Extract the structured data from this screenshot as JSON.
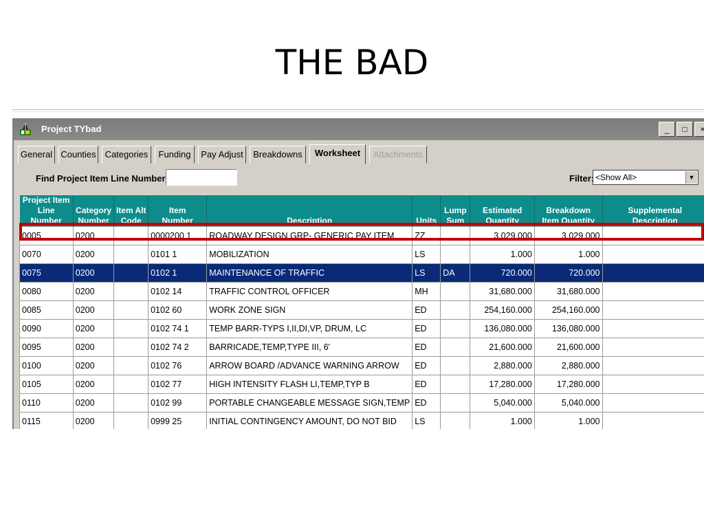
{
  "slide": {
    "title": "THE BAD"
  },
  "window": {
    "title": "Project TYbad",
    "minimize": "_",
    "maximize": "□",
    "close": "×"
  },
  "tabs": [
    {
      "label": "General",
      "state": "normal"
    },
    {
      "label": "Counties",
      "state": "normal"
    },
    {
      "label": "Categories",
      "state": "normal"
    },
    {
      "label": "Funding",
      "state": "normal"
    },
    {
      "label": "Pay Adjust",
      "state": "normal"
    },
    {
      "label": "Breakdowns",
      "state": "normal"
    },
    {
      "label": "Worksheet",
      "state": "active"
    },
    {
      "label": "Attachments",
      "state": "disabled"
    }
  ],
  "find": {
    "label": "Find Project Item Line Number:",
    "value": ""
  },
  "filter": {
    "label": "Filter:",
    "value": "<Show All>"
  },
  "columns": [
    [
      "Project Item",
      "Line Number"
    ],
    [
      "Category",
      "Number"
    ],
    [
      "Item Alt",
      "Code"
    ],
    [
      "Item",
      "Number"
    ],
    [
      "",
      "Description"
    ],
    [
      "",
      "Units"
    ],
    [
      "Lump",
      "Sum"
    ],
    [
      "Estimated",
      "Quantity"
    ],
    [
      "Breakdown",
      "Item Quantity"
    ],
    [
      "Supplemental",
      "Description"
    ]
  ],
  "rows": [
    [
      "0005",
      "0200",
      "",
      "0000200 1",
      "ROADWAY DESIGN GRP- GENERIC PAY ITEM",
      "ZZ",
      "",
      "3,029.000",
      "3,029.000",
      ""
    ],
    [
      "0070",
      "0200",
      "",
      "0101 1",
      "MOBILIZATION",
      "LS",
      "",
      "1.000",
      "1.000",
      ""
    ],
    [
      "0075",
      "0200",
      "",
      "0102 1",
      "MAINTENANCE OF TRAFFIC",
      "LS",
      "DA",
      "720.000",
      "720.000",
      ""
    ],
    [
      "0080",
      "0200",
      "",
      "0102 14",
      "TRAFFIC CONTROL OFFICER",
      "MH",
      "",
      "31,680.000",
      "31,680.000",
      ""
    ],
    [
      "0085",
      "0200",
      "",
      "0102 60",
      "WORK ZONE SIGN",
      "ED",
      "",
      "254,160.000",
      "254,160.000",
      ""
    ],
    [
      "0090",
      "0200",
      "",
      "0102 74 1",
      "TEMP BARR-TYPS I,II,DI,VP, DRUM, LC",
      "ED",
      "",
      "136,080.000",
      "136,080.000",
      ""
    ],
    [
      "0095",
      "0200",
      "",
      "0102 74 2",
      "BARRICADE,TEMP,TYPE III, 6'",
      "ED",
      "",
      "21,600.000",
      "21,600.000",
      ""
    ],
    [
      "0100",
      "0200",
      "",
      "0102 76",
      "ARROW BOARD /ADVANCE WARNING ARROW",
      "ED",
      "",
      "2,880.000",
      "2,880.000",
      ""
    ],
    [
      "0105",
      "0200",
      "",
      "0102 77",
      "HIGH INTENSITY FLASH LI,TEMP,TYP B",
      "ED",
      "",
      "17,280.000",
      "17,280.000",
      ""
    ],
    [
      "0110",
      "0200",
      "",
      "0102 99",
      "PORTABLE CHANGEABLE MESSAGE SIGN,TEMP",
      "ED",
      "",
      "5,040.000",
      "5,040.000",
      ""
    ],
    [
      "0115",
      "0200",
      "",
      "0999 25",
      "INITIAL CONTINGENCY AMOUNT, DO NOT BID",
      "LS",
      "",
      "1.000",
      "1.000",
      ""
    ]
  ],
  "selected_row": 2,
  "highlighted_row": 0,
  "colors": {
    "header": "#0e8c8c",
    "selection": "#0a2a78",
    "highlight": "#c00000",
    "value_text": "#2828d8"
  }
}
